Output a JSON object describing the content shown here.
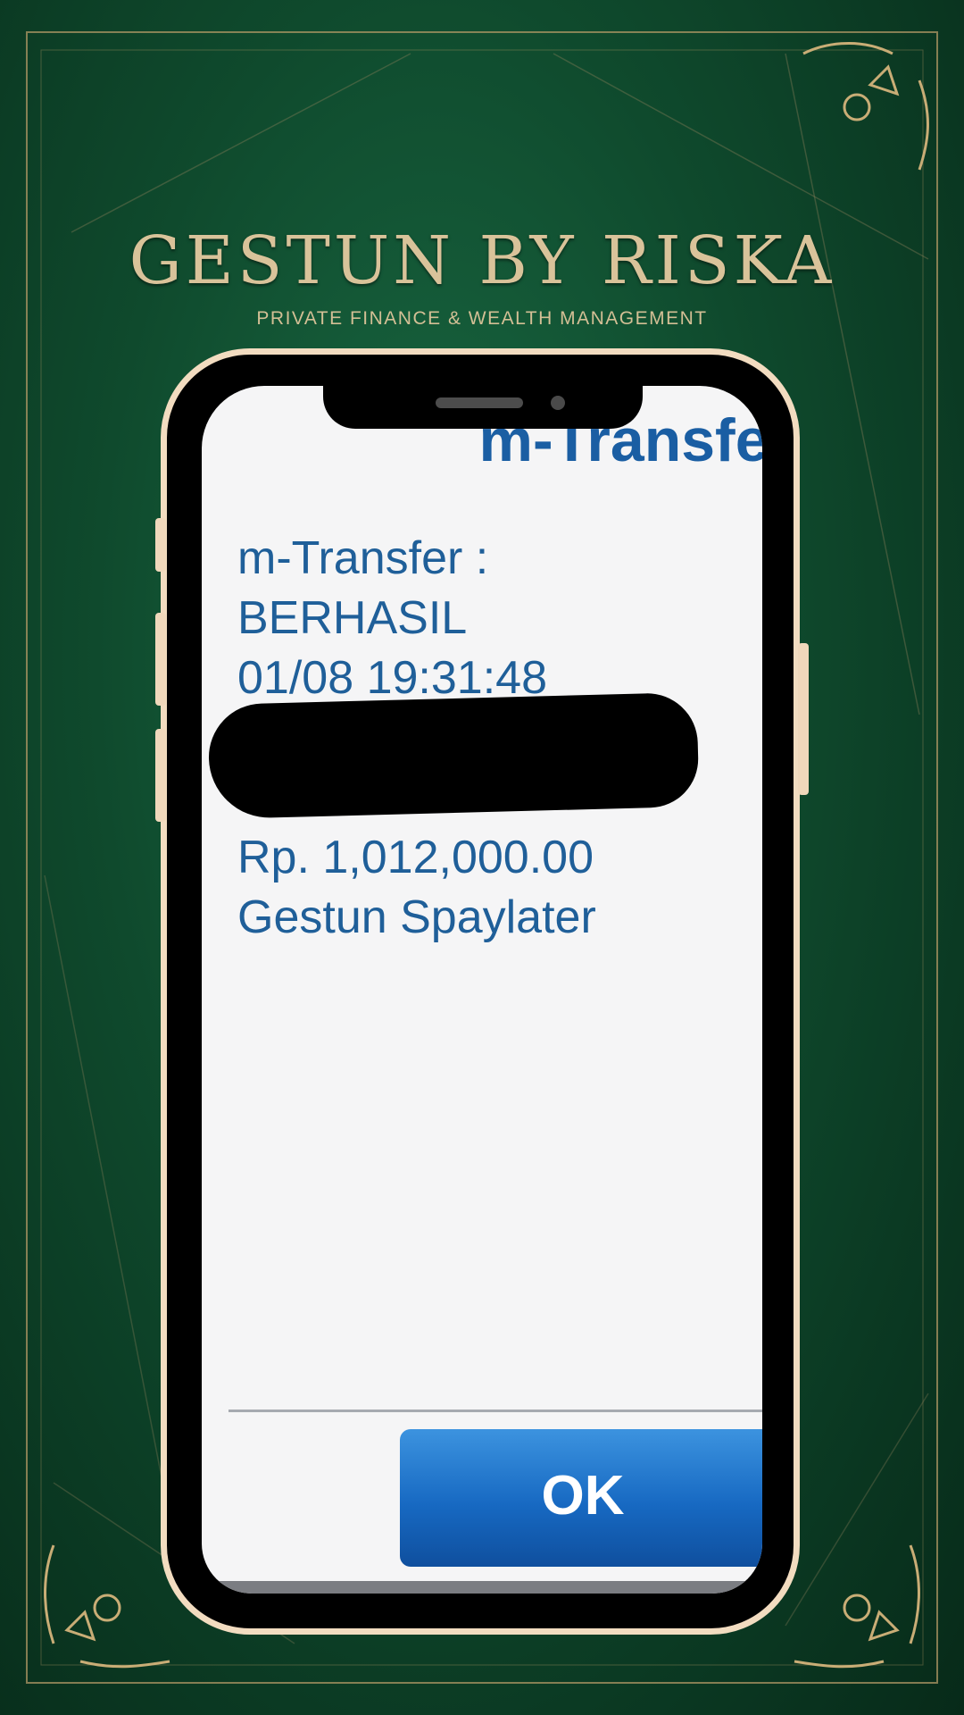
{
  "brand": {
    "title": "GESTUN BY RISKA",
    "subtitle": "PRIVATE FINANCE & WEALTH MANAGEMENT"
  },
  "screen": {
    "header": "m-Transfer",
    "lines": [
      "m-Transfer :",
      "BERHASIL",
      "01/08 19:31:48",
      "",
      "",
      "Rp. 1,012,000.00",
      "Gestun Spaylater"
    ],
    "ok_label": "OK"
  },
  "colors": {
    "background": "#0f4a2d",
    "gold": "#d9c39a",
    "text_blue": "#1f5f99",
    "button_blue": "#1769c2"
  }
}
